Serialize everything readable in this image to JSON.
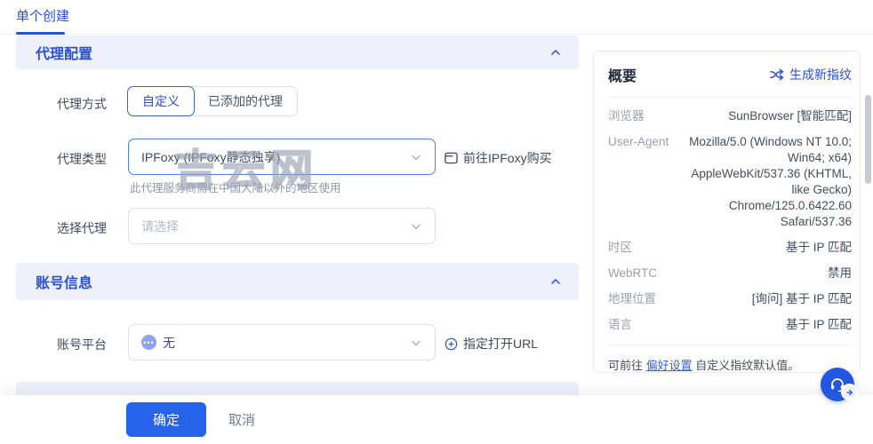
{
  "tabs": {
    "single_create": "单个创建"
  },
  "watermark": "吉云网",
  "proxy_section": {
    "title": "代理配置",
    "method_label": "代理方式",
    "method_options": [
      {
        "label": "自定义",
        "selected": true
      },
      {
        "label": "已添加的代理",
        "selected": false
      }
    ],
    "type_label": "代理类型",
    "type_value": "IPFoxy (IPFoxy静态独享)",
    "buy_link": "前往IPFoxy购买",
    "type_hint": "此代理服务商需在中国大陆以外的地区使用",
    "choose_label": "选择代理",
    "choose_placeholder": "请选择"
  },
  "account_section": {
    "title": "账号信息",
    "platform_label": "账号平台",
    "platform_value": "无",
    "open_url_link": "指定打开URL"
  },
  "footer": {
    "confirm": "确定",
    "cancel": "取消"
  },
  "summary": {
    "title": "概要",
    "regenerate": "生成新指纹",
    "rows": [
      {
        "label": "浏览器",
        "value": "SunBrowser [智能匹配]"
      },
      {
        "label": "User-Agent",
        "value": "Mozilla/5.0 (Windows NT 10.0; Win64; x64) AppleWebKit/537.36 (KHTML, like Gecko) Chrome/125.0.6422.60 Safari/537.36"
      },
      {
        "label": "时区",
        "value": "基于 IP 匹配"
      },
      {
        "label": "WebRTC",
        "value": "禁用"
      },
      {
        "label": "地理位置",
        "value": "[询问] 基于 IP 匹配"
      },
      {
        "label": "语言",
        "value": "基于 IP 匹配"
      }
    ],
    "note_prefix": "可前往 ",
    "note_link": "偏好设置",
    "note_suffix": " 自定义指纹默认值。"
  },
  "icons": {
    "regenerate": "shuffle-icon",
    "buy": "browser-window-icon",
    "open_url": "plus-circle-icon",
    "help": "headset-icon"
  },
  "colors": {
    "accent": "#2b50d8",
    "button": "#2563eb",
    "section_bg": "#eef1fb",
    "focus_border": "#4c7df5"
  }
}
